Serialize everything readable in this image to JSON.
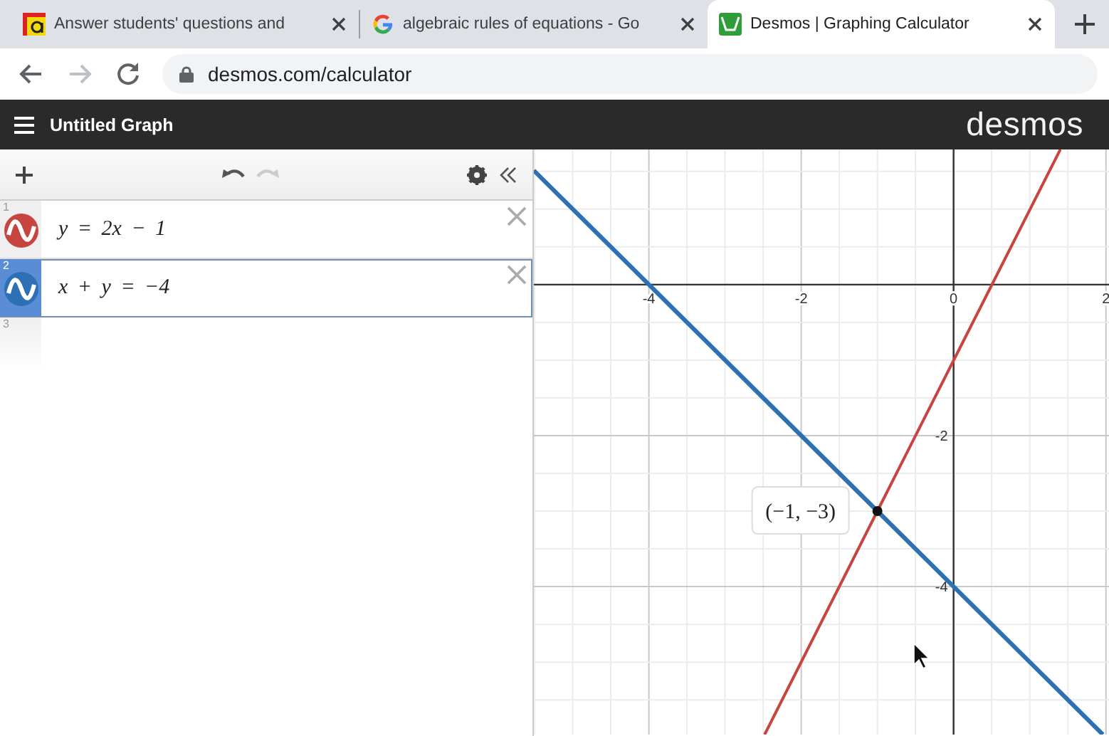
{
  "browser": {
    "tabs": [
      {
        "title": "Answer students' questions and",
        "selected": false
      },
      {
        "title": "algebraic rules of equations - Go",
        "selected": false
      },
      {
        "title": "Desmos | Graphing Calculator",
        "selected": true
      }
    ],
    "address": "desmos.com/calculator"
  },
  "header": {
    "title": "Untitled Graph",
    "logo": "desmos"
  },
  "expressions": [
    {
      "kind": "expression",
      "number": "1",
      "latex": "y = 2x − 1",
      "color": "#c74440",
      "selected": false
    },
    {
      "kind": "expression",
      "number": "2",
      "latex": "x + y = −4",
      "color": "#2d70b3",
      "selected": true
    },
    {
      "kind": "empty",
      "number": "3"
    }
  ],
  "graph": {
    "chart_data": {
      "type": "line",
      "grid": true,
      "x": [
        -5.51,
        -2.48,
        -1,
        1.4,
        1.96
      ],
      "xlim": [
        -5.51,
        2.04
      ],
      "ylim": [
        -5.96,
        1.79
      ],
      "xticks": [
        {
          "value": -4,
          "label": "-4"
        },
        {
          "value": -2,
          "label": "-2"
        },
        {
          "value": 0,
          "label": "0"
        },
        {
          "value": 2,
          "label": "2"
        }
      ],
      "yticks": [
        {
          "value": -2,
          "label": "-2"
        },
        {
          "value": -4,
          "label": "-4"
        }
      ],
      "series": [
        {
          "color": "#c74440",
          "values": [
            null,
            -5.96,
            -3,
            1.79,
            null
          ]
        },
        {
          "color": "#2d70b3",
          "values": [
            1.51,
            -1.52,
            -3,
            -5.4,
            -5.96
          ]
        }
      ],
      "annotations": [
        {
          "x": -1,
          "y": -3,
          "text": "(−1, −3)"
        }
      ]
    }
  }
}
